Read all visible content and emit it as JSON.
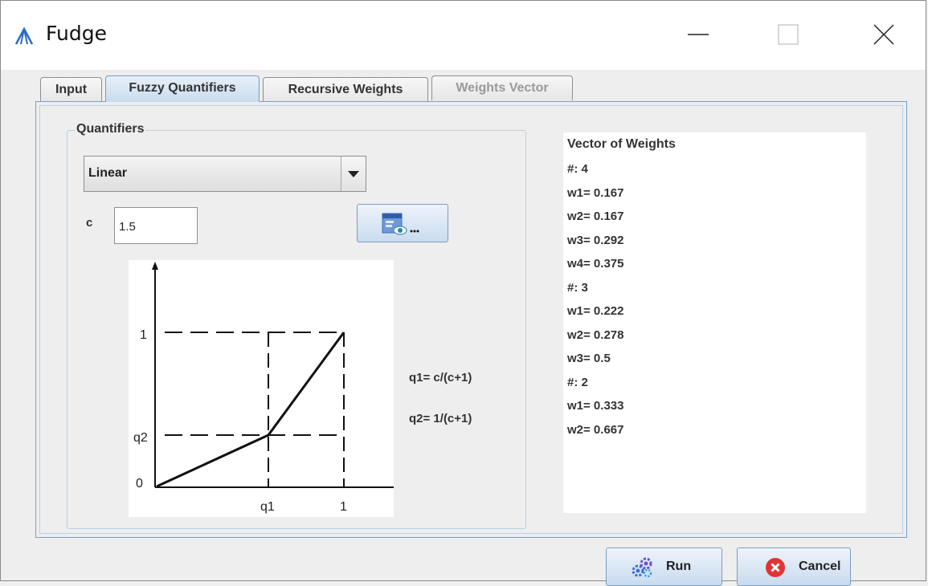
{
  "window": {
    "title": "Fudge"
  },
  "tabs": [
    {
      "label": "Input",
      "state": "normal"
    },
    {
      "label": "Fuzzy Quantifiers",
      "state": "active"
    },
    {
      "label": "Recursive Weights",
      "state": "normal"
    },
    {
      "label": "Weights Vector",
      "state": "disabled"
    }
  ],
  "quantifiers": {
    "legend": "Quantifiers",
    "selected": "Linear",
    "c_label": "c",
    "c_value": "1.5"
  },
  "plot": {
    "y_labels": {
      "top": "1",
      "mid": "q2",
      "zero": "0"
    },
    "x_labels": {
      "q1": "q1",
      "one": "1"
    },
    "q1_formula": "q1= c/(c+1)",
    "q2_formula": "q2= 1/(c+1)"
  },
  "weights": {
    "title": "Vector of Weights",
    "lines": [
      "#: 4",
      "w1= 0.167",
      "w2= 0.167",
      "w3= 0.292",
      "w4= 0.375",
      "#: 3",
      "w1= 0.222",
      "w2= 0.278",
      "w3= 0.5",
      "#: 2",
      "w1= 0.333",
      "w2= 0.667"
    ]
  },
  "buttons": {
    "run": "Run",
    "cancel": "Cancel"
  },
  "colors": {
    "accent": "#7a9ec0",
    "tab_active": "#c8dcef",
    "cancel_icon": "#e03535",
    "run_icon": "#3a6fd8"
  }
}
